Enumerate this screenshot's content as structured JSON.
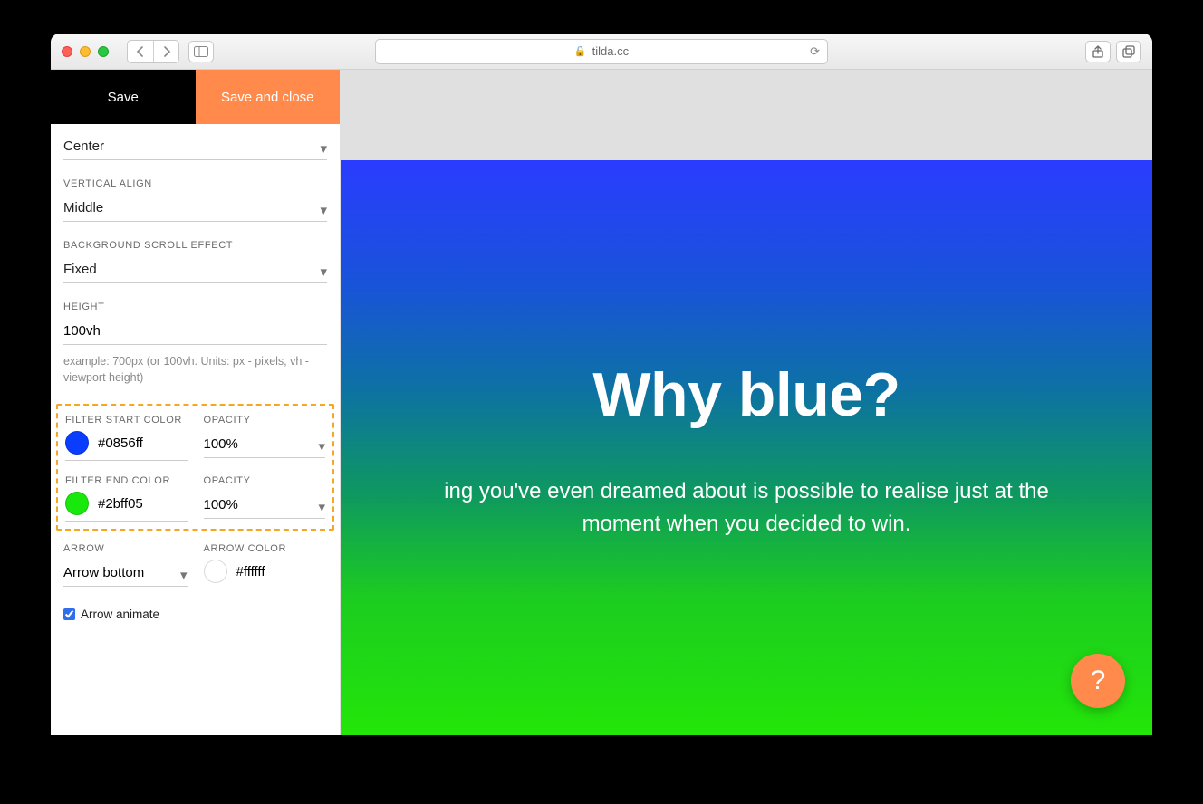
{
  "browser": {
    "url_host": "tilda.cc"
  },
  "panel": {
    "actions": {
      "save": "Save",
      "save_close": "Save and close"
    },
    "align": {
      "value": "Center"
    },
    "valign": {
      "label": "VERTICAL ALIGN",
      "value": "Middle"
    },
    "bgscroll": {
      "label": "BACKGROUND SCROLL EFFECT",
      "value": "Fixed"
    },
    "height": {
      "label": "HEIGHT",
      "value": "100vh",
      "hint": "example: 700px (or 100vh. Units: px - pixels, vh - viewport height)"
    },
    "filter_start": {
      "label": "FILTER START COLOR",
      "value": "#0856ff",
      "opacity_label": "OPACITY",
      "opacity": "100%"
    },
    "filter_end": {
      "label": "FILTER END COLOR",
      "value": "#2bff05",
      "opacity_label": "OPACITY",
      "opacity": "100%"
    },
    "arrow": {
      "label": "ARROW",
      "value": "Arrow bottom",
      "color_label": "ARROW COLOR",
      "color": "#ffffff",
      "animate_label": "Arrow animate"
    }
  },
  "hero": {
    "title": "Why blue?",
    "subtitle": "ing you've even dreamed about is possible to realise just at the moment when you decided to win."
  },
  "help": "?"
}
